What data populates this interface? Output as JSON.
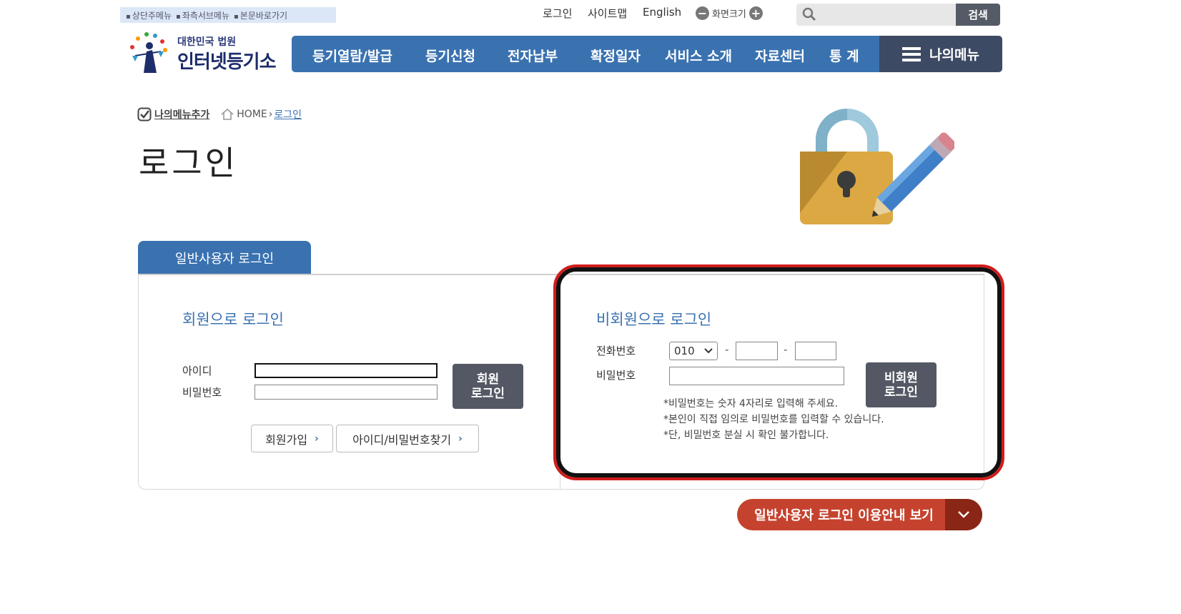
{
  "skip_links": [
    "상단주메뉴",
    "좌측서브메뉴",
    "본문바로가기"
  ],
  "util": {
    "login": "로그인",
    "sitemap": "사이트맵",
    "english": "English",
    "zoom_label": "화면크기",
    "zoom_minus": "−",
    "zoom_plus": "+"
  },
  "search": {
    "placeholder": "",
    "button": "검색"
  },
  "logo": {
    "small": "대한민국 법원",
    "big": "인터넷등기소"
  },
  "nav": {
    "items": [
      "등기열람/발급",
      "등기신청",
      "전자납부",
      "확정일자",
      "서비스 소개",
      "자료센터",
      "통 계"
    ],
    "my_menu": "나의메뉴"
  },
  "breadcrumb": {
    "add_menu": "나의메뉴추가",
    "home": "HOME",
    "current": "로그인"
  },
  "page_title": "로그인",
  "tab": "일반사용자 로그인",
  "member": {
    "title": "회원으로 로그인",
    "id_label": "아이디",
    "pw_label": "비밀번호",
    "id_value": "",
    "pw_value": "",
    "login_button_line1": "회원",
    "login_button_line2": "로그인",
    "signup": "회원가입",
    "find": "아이디/비밀번호찾기"
  },
  "guest": {
    "title": "비회원으로 로그인",
    "phone_label": "전화번호",
    "pw_label": "비밀번호",
    "phone_prefix": "010",
    "phone_mid": "",
    "phone_last": "",
    "dash": "-",
    "pw_value": "",
    "login_button_line1": "비회원",
    "login_button_line2": "로그인",
    "notes": [
      "*비밀번호는 숫자 4자리로 입력해 주세요.",
      "*본인이 직접 임의로 비밀번호를 입력할 수 있습니다.",
      "*단, 비밀번호 분실 시 확인 불가합니다."
    ]
  },
  "guide_button": "일반사용자 로그인 이용안내 보기",
  "colors": {
    "nav_blue": "#3a72b0",
    "my_menu": "#3d4a63",
    "guide": "#c5432e",
    "highlight": "#d21c1c"
  }
}
